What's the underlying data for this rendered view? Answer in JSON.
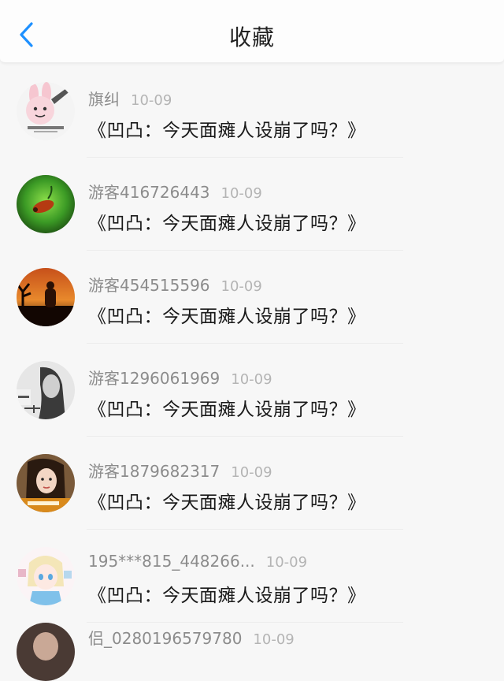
{
  "header": {
    "title": "收藏",
    "back_icon": "chevron-left-icon",
    "accent_color": "#1e90ff"
  },
  "items": [
    {
      "username": "旗纠",
      "date": "10-09",
      "content": "《凹凸：今天面瘫人设崩了吗？》"
    },
    {
      "username": "游客416726443",
      "date": "10-09",
      "content": "《凹凸：今天面瘫人设崩了吗？》"
    },
    {
      "username": "游客454515596",
      "date": "10-09",
      "content": "《凹凸：今天面瘫人设崩了吗？》"
    },
    {
      "username": "游客1296061969",
      "date": "10-09",
      "content": "《凹凸：今天面瘫人设崩了吗？》"
    },
    {
      "username": "游客1879682317",
      "date": "10-09",
      "content": "《凹凸：今天面瘫人设崩了吗？》"
    },
    {
      "username": "195***815_448266...",
      "date": "10-09",
      "content": "《凹凸：今天面瘫人设崩了吗？》"
    },
    {
      "username": "侣_0280196579780",
      "date": "10-09",
      "content": ""
    }
  ]
}
